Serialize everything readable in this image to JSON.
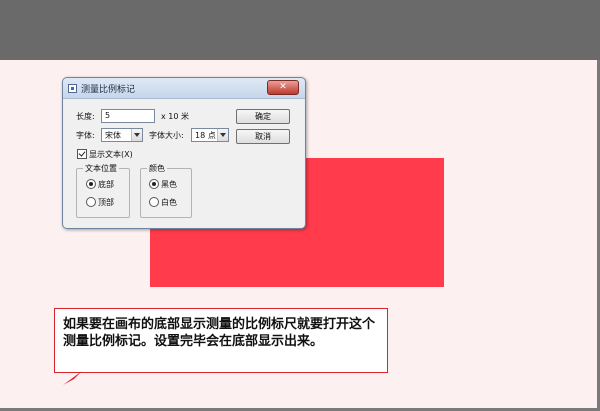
{
  "dialog": {
    "title": "测量比例标记",
    "close_symbol": "✕",
    "length_label": "长度:",
    "length_value": "5",
    "length_unit": "x 10 米",
    "ok_label": "确定",
    "cancel_label": "取消",
    "font_label": "字体:",
    "font_value": "宋体",
    "fontsize_label": "字体大小:",
    "fontsize_value": "18 点",
    "show_text_label": "显示文本(X)",
    "show_text_checked": true,
    "position_group": {
      "title": "文本位置",
      "options": [
        "底部",
        "顶部"
      ],
      "selected": "底部"
    },
    "color_group": {
      "title": "颜色",
      "options": [
        "黑色",
        "白色"
      ],
      "selected": "黑色"
    }
  },
  "canvas": {
    "rect_color": "#ff3b4c"
  },
  "callout": {
    "text": "如果要在画布的底部显示测量的比例标尺就要打开这个测量比例标记。设置完毕会在底部显示出来。",
    "border_color": "#d9242b"
  }
}
